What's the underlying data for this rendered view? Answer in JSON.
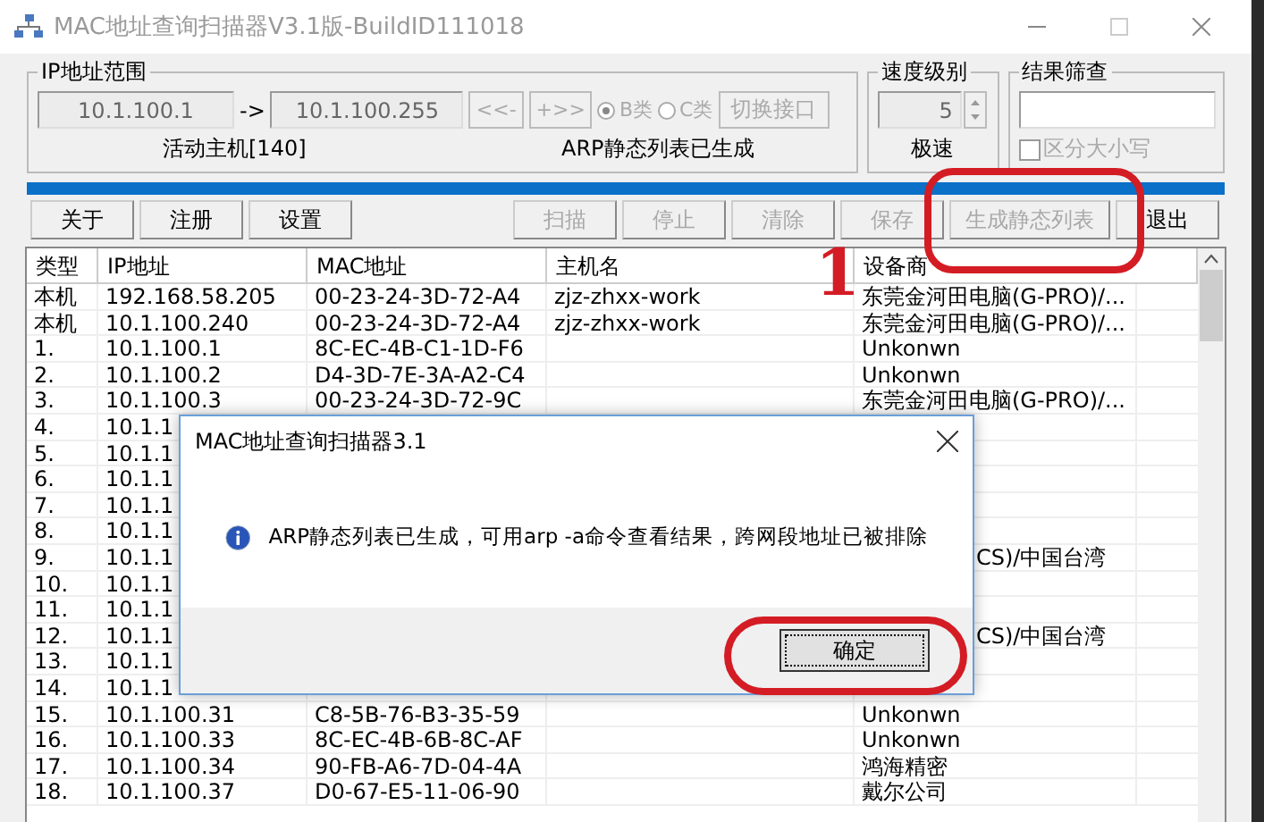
{
  "window": {
    "title": "MAC地址查询扫描器V3.1版-BuildID111018"
  },
  "ip_range": {
    "label": "IP地址范围",
    "start": "10.1.100.1",
    "arrow": "->",
    "end": "10.1.100.255",
    "prev_button": "<<-",
    "next_button": "+>>",
    "classes": [
      {
        "label": "B类",
        "selected": true
      },
      {
        "label": "C类",
        "selected": false
      }
    ],
    "switch_button": "切换接口",
    "active_hosts": "活动主机[140]",
    "status": "ARP静态列表已生成"
  },
  "speed": {
    "label": "速度级别",
    "value": "5",
    "caption": "极速"
  },
  "filter": {
    "label": "结果筛查",
    "case_sensitive": {
      "label": "区分大小写",
      "checked": false
    }
  },
  "progress": {
    "level": 1
  },
  "left_buttons": [
    {
      "label": "关于",
      "disabled": false
    },
    {
      "label": "注册",
      "disabled": false
    },
    {
      "label": "设置",
      "disabled": false
    }
  ],
  "right_buttons": [
    {
      "label": "扫描",
      "disabled": true
    },
    {
      "label": "停止",
      "disabled": true
    },
    {
      "label": "清除",
      "disabled": true
    },
    {
      "label": "保存",
      "disabled": true
    },
    {
      "label": "生成静态列表",
      "disabled": true
    },
    {
      "label": "退出",
      "disabled": false
    }
  ],
  "table": {
    "columns": [
      "类型",
      "IP地址",
      "MAC地址",
      "主机名",
      "设备商"
    ],
    "rows": [
      {
        "type": "本机",
        "ip": "192.168.58.205",
        "mac": "00-23-24-3D-72-A4",
        "host": "zjz-zhxx-work",
        "vendor": "东莞金河田电脑(G-PRO)/..."
      },
      {
        "type": "本机",
        "ip": "10.1.100.240",
        "mac": "00-23-24-3D-72-A4",
        "host": "zjz-zhxx-work",
        "vendor": "东莞金河田电脑(G-PRO)/..."
      },
      {
        "type": "1.",
        "ip": "10.1.100.1",
        "mac": "8C-EC-4B-C1-1D-F6",
        "vendor": "Unkonwn"
      },
      {
        "type": "2.",
        "ip": "10.1.100.2",
        "mac": "D4-3D-7E-3A-A2-C4",
        "vendor": "Unkonwn"
      },
      {
        "type": "3.",
        "ip": "10.1.100.3",
        "mac": "00-23-24-3D-72-9C",
        "vendor": "东莞金河田电脑(G-PRO)/..."
      },
      {
        "type": "4.",
        "ip": "10.1.1"
      },
      {
        "type": "5.",
        "ip": "10.1.1"
      },
      {
        "type": "6.",
        "ip": "10.1.1"
      },
      {
        "type": "7.",
        "ip": "10.1.1"
      },
      {
        "type": "8.",
        "ip": "10.1.1"
      },
      {
        "type": "9.",
        "ip": "10.1.1",
        "vendor_tail": "CS)/中国台湾"
      },
      {
        "type": "10.",
        "ip": "10.1.1"
      },
      {
        "type": "11.",
        "ip": "10.1.1"
      },
      {
        "type": "12.",
        "ip": "10.1.1",
        "vendor_tail": "CS)/中国台湾"
      },
      {
        "type": "13.",
        "ip": "10.1.1"
      },
      {
        "type": "14.",
        "ip": "10.1.1"
      },
      {
        "type": "15.",
        "ip": "10.1.100.31",
        "mac": "C8-5B-76-B3-35-59",
        "vendor": "Unkonwn"
      },
      {
        "type": "16.",
        "ip": "10.1.100.33",
        "mac": "8C-EC-4B-6B-8C-AF",
        "vendor": "Unkonwn"
      },
      {
        "type": "17.",
        "ip": "10.1.100.34",
        "mac": "90-FB-A6-7D-04-4A",
        "vendor": "鸿海精密"
      },
      {
        "type": "18.",
        "ip": "10.1.100.37",
        "mac": "D0-67-E5-11-06-90",
        "vendor": "戴尔公司"
      }
    ]
  },
  "dialog": {
    "title": "MAC地址查询扫描器3.1",
    "message": "ARP静态列表已生成，可用arp -a命令查看结果，跨网段地址已被排除",
    "ok_button": "确定"
  },
  "annotation": {
    "marker": "1"
  }
}
